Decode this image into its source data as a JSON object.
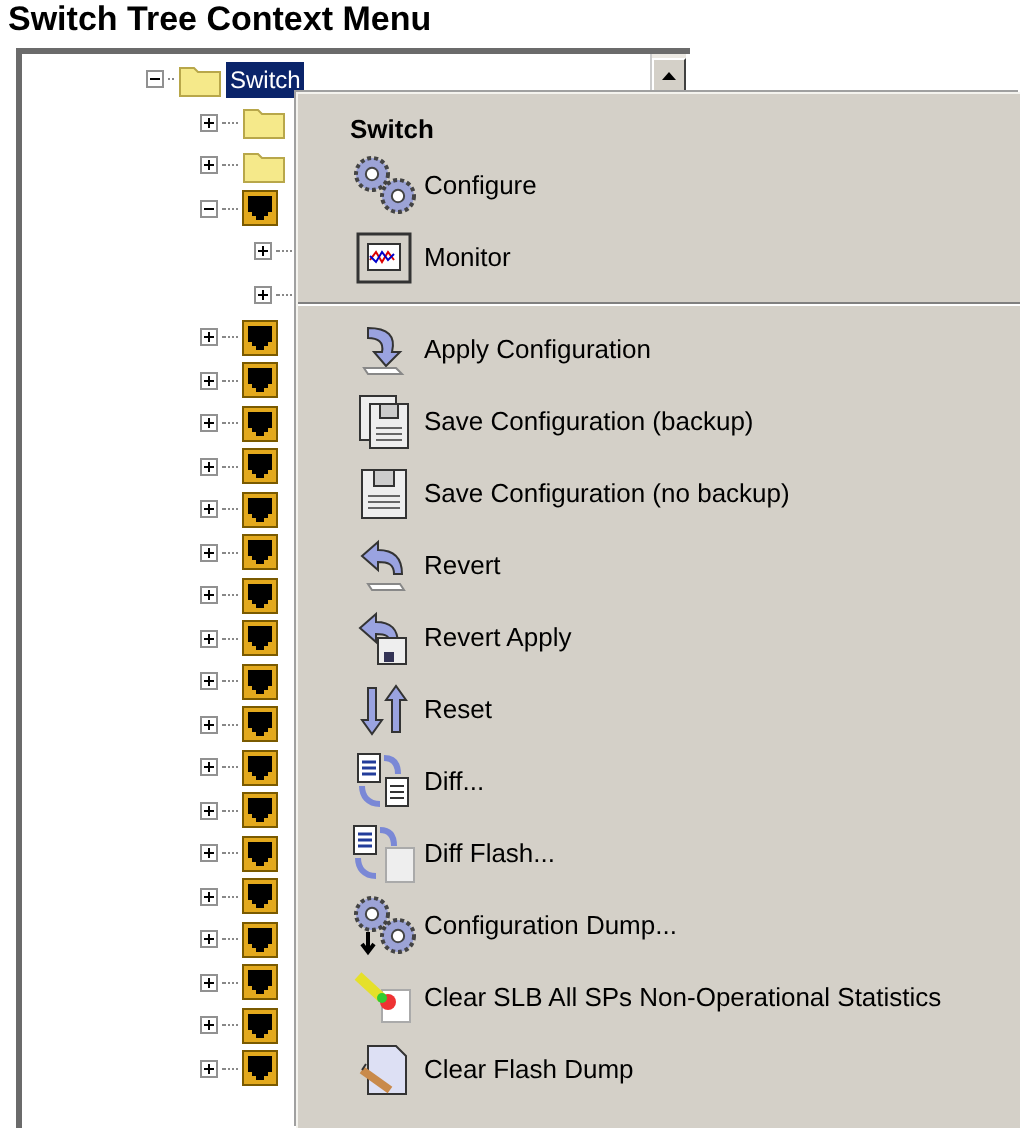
{
  "title": "Switch Tree Context Menu",
  "tree": {
    "label": "Switch",
    "selected": true,
    "expanded": true,
    "children": [
      {
        "kind": "folder",
        "expanded": false
      },
      {
        "kind": "folder",
        "expanded": false
      },
      {
        "kind": "port",
        "expanded": true,
        "children": [
          {
            "expanded": false
          },
          {
            "expanded": false
          }
        ]
      },
      {
        "kind": "port",
        "expanded": false
      },
      {
        "kind": "port",
        "expanded": false
      },
      {
        "kind": "port",
        "expanded": false
      },
      {
        "kind": "port",
        "expanded": false
      },
      {
        "kind": "port",
        "expanded": false
      },
      {
        "kind": "port",
        "expanded": false
      },
      {
        "kind": "port",
        "expanded": false
      },
      {
        "kind": "port",
        "expanded": false
      },
      {
        "kind": "port",
        "expanded": false
      },
      {
        "kind": "port",
        "expanded": false
      },
      {
        "kind": "port",
        "expanded": false
      },
      {
        "kind": "port",
        "expanded": false
      },
      {
        "kind": "port",
        "expanded": false
      },
      {
        "kind": "port",
        "expanded": false
      },
      {
        "kind": "port",
        "expanded": false
      },
      {
        "kind": "port",
        "expanded": false
      },
      {
        "kind": "port",
        "expanded": false
      },
      {
        "kind": "port",
        "expanded": false
      }
    ]
  },
  "context_menu": {
    "header": "Switch",
    "sections": [
      [
        {
          "label": "Configure"
        },
        {
          "label": "Monitor"
        }
      ],
      [
        {
          "label": "Apply Configuration"
        },
        {
          "label": "Save Configuration (backup)"
        },
        {
          "label": "Save Configuration (no backup)"
        },
        {
          "label": "Revert"
        },
        {
          "label": "Revert Apply"
        },
        {
          "label": "Reset"
        },
        {
          "label": "Diff..."
        },
        {
          "label": "Diff Flash..."
        },
        {
          "label": "Configuration Dump..."
        },
        {
          "label": "Clear SLB All SPs Non-Operational Statistics"
        },
        {
          "label": "Clear Flash Dump"
        }
      ]
    ]
  }
}
